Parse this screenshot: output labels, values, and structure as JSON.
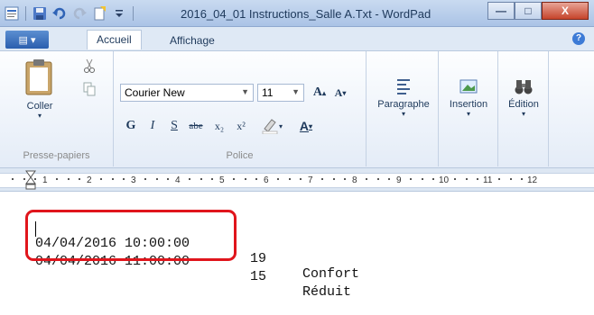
{
  "window": {
    "title": "2016_04_01 Instructions_Salle A.Txt - WordPad"
  },
  "window_buttons": {
    "minimize": "—",
    "maximize": "□",
    "close": "X"
  },
  "menu": {
    "file_label": "▤ ▾"
  },
  "tabs": [
    {
      "label": "Accueil",
      "active": true
    },
    {
      "label": "Affichage",
      "active": false
    }
  ],
  "help": "?",
  "ribbon": {
    "clipboard": {
      "paste_label": "Coller",
      "group_label": "Presse-papiers"
    },
    "font": {
      "group_label": "Police",
      "font_name": "Courier New",
      "font_size": "11",
      "grow": "A",
      "shrink": "A",
      "bold": "G",
      "italic": "I",
      "underline": "S",
      "strike": "abe",
      "subscript": "x₂",
      "superscript": "x²",
      "text_color": "A"
    },
    "paragraph_label": "Paragraphe",
    "insert_label": "Insertion",
    "edit_label": "Édition"
  },
  "ruler": [
    "1",
    "2",
    "3",
    "4",
    "5",
    "6",
    "7",
    "8",
    "9",
    "10",
    "11",
    "12"
  ],
  "document": {
    "lines": [
      {
        "datetime": "04/04/2016 10:00:00",
        "value": "19",
        "mode": "Confort"
      },
      {
        "datetime": "04/04/2016 11:00:00",
        "value": "15",
        "mode": "Réduit"
      }
    ]
  },
  "colors": {
    "highlight": "#e0151c",
    "accent": "#2a5eae"
  }
}
